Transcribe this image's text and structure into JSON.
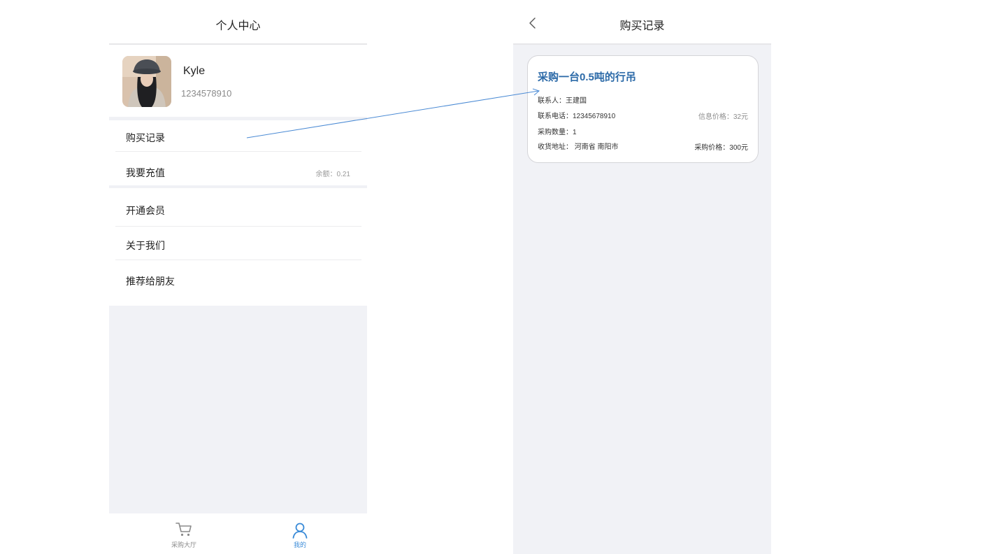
{
  "profile_page": {
    "title": "个人中心",
    "user": {
      "name": "Kyle",
      "phone": "1234578910"
    },
    "menu": {
      "purchase_records": "购买记录",
      "recharge": "我要充值",
      "balance": "余额：0.21",
      "membership": "开通会员",
      "about_us": "关于我们",
      "recommend": "推荐给朋友"
    },
    "tabs": [
      {
        "label": "采购大厅",
        "icon": "cart-icon",
        "active": false
      },
      {
        "label": "我的",
        "icon": "user-icon",
        "active": true
      }
    ]
  },
  "records_page": {
    "title": "购买记录",
    "back_icon": "chevron-left-icon",
    "record": {
      "title": "采购一台0.5吨的行吊",
      "contact": "联系人：王建国",
      "phone": "联系电话：12345678910",
      "quantity": "采购数量：1",
      "address": "收货地址： 河南省 南阳市",
      "info_price": "信息价格：32元",
      "purchase_price": "采购价格：300元"
    }
  },
  "colors": {
    "accent": "#2c6aa8",
    "tab_active": "#3a8bd8",
    "tab_inactive": "#8a8a8a",
    "background_gray": "#f1f2f6",
    "annotation_arrow": "#4a8ad4"
  }
}
